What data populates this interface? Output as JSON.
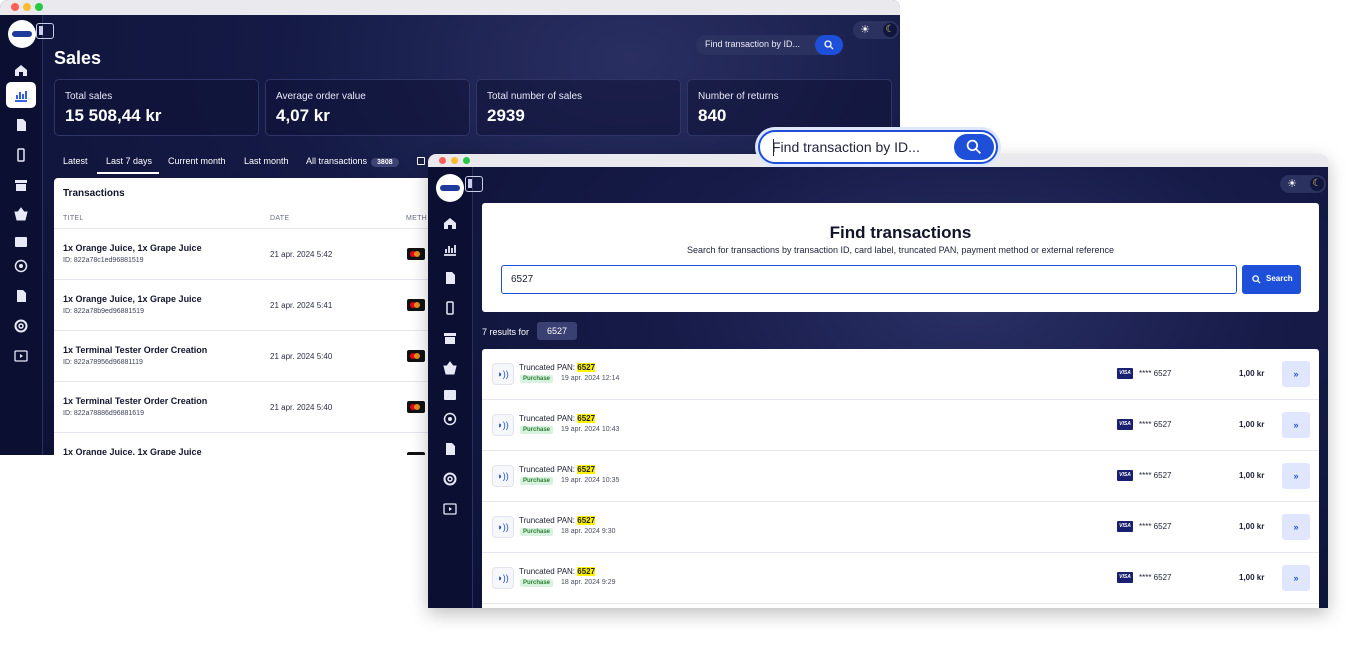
{
  "sales_window": {
    "search_placeholder": "Find transaction by ID...",
    "page_title": "Sales",
    "stats": [
      {
        "label": "Total sales",
        "value": "15 508,44 kr"
      },
      {
        "label": "Average order value",
        "value": "4,07 kr"
      },
      {
        "label": "Total number of sales",
        "value": "2939"
      },
      {
        "label": "Number of returns",
        "value": "840"
      }
    ],
    "tabs": [
      {
        "label": "Latest"
      },
      {
        "label": "Last 7 days",
        "active": true
      },
      {
        "label": "Current month"
      },
      {
        "label": "Last month"
      },
      {
        "label": "All transactions",
        "count": "3808"
      }
    ],
    "transactions_title": "Transactions",
    "columns": {
      "title": "TITEL",
      "date": "DATE",
      "method": "METH"
    },
    "rows": [
      {
        "title": "1x Orange Juice, 1x Grape Juice",
        "id": "ID: 822a78c1ed96881519",
        "date": "21 apr. 2024 5:42"
      },
      {
        "title": "1x Orange Juice, 1x Grape Juice",
        "id": "ID: 822a78b9ed96881519",
        "date": "21 apr. 2024 5:41"
      },
      {
        "title": "1x Terminal Tester Order Creation",
        "id": "ID: 822a78956d96881119",
        "date": "21 apr. 2024 5:40"
      },
      {
        "title": "1x Terminal Tester Order Creation",
        "id": "ID: 822a78886d96881619",
        "date": "21 apr. 2024 5:40"
      },
      {
        "title": "1x Orange Juice, 1x Grape Juice",
        "id": "",
        "date": ""
      }
    ]
  },
  "floating_search": {
    "placeholder": "Find transaction by ID..."
  },
  "find_window": {
    "heading": "Find transactions",
    "subheading": "Search for transactions by transaction ID, card label, truncated PAN, payment method or external reference",
    "query": "6527",
    "search_button": "Search",
    "results_prefix": "7 results for",
    "results": [
      {
        "label": "Truncated PAN: ",
        "match": "6527",
        "type": "Purchase",
        "date": "19 apr. 2024 12:14",
        "card": "VISA",
        "pan": "**** 6527",
        "amount": "1,00 kr"
      },
      {
        "label": "Truncated PAN: ",
        "match": "6527",
        "type": "Purchase",
        "date": "19 apr. 2024 10:43",
        "card": "VISA",
        "pan": "**** 6527",
        "amount": "1,00 kr"
      },
      {
        "label": "Truncated PAN: ",
        "match": "6527",
        "type": "Purchase",
        "date": "19 apr. 2024 10:35",
        "card": "VISA",
        "pan": "**** 6527",
        "amount": "1,00 kr"
      },
      {
        "label": "Truncated PAN: ",
        "match": "6527",
        "type": "Purchase",
        "date": "18 apr. 2024 9:30",
        "card": "VISA",
        "pan": "**** 6527",
        "amount": "1,00 kr"
      },
      {
        "label": "Truncated PAN: ",
        "match": "6527",
        "type": "Purchase",
        "date": "18 apr. 2024 9:29",
        "card": "VISA",
        "pan": "**** 6527",
        "amount": "1,00 kr"
      }
    ]
  },
  "icons": {
    "sidebar": [
      "home-icon",
      "chart-icon",
      "document-icon",
      "terminal-icon",
      "store-icon",
      "basket-icon",
      "wallet-icon",
      "coin-icon",
      "invoice-icon",
      "support-icon",
      "video-icon"
    ],
    "go": "chevron-double-right-icon",
    "row": "contactless-icon"
  },
  "colors": {
    "accent": "#1d4fd8",
    "background": "#0d1236",
    "highlight": "#fff200",
    "purchase_badge": "#d7f3df"
  }
}
